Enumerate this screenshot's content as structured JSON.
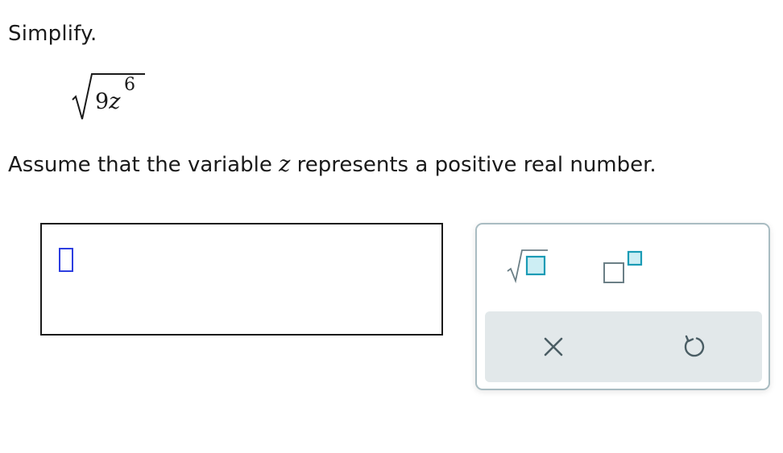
{
  "question": {
    "instruction": "Simplify.",
    "expression": {
      "coefficient": "9",
      "variable": "z",
      "exponent": "6"
    },
    "assumption": {
      "before": "Assume that the variable ",
      "variable": "z",
      "after": " represents a positive real number."
    }
  },
  "answer": {
    "value": ""
  },
  "palette": {
    "tools": [
      {
        "icon": "square-root-icon"
      },
      {
        "icon": "exponent-icon"
      }
    ],
    "actions": [
      {
        "icon": "clear-x-icon"
      },
      {
        "icon": "undo-icon"
      }
    ]
  },
  "colors": {
    "placeholder_border": "#2d3ee0",
    "tool_teal": "#1a9bb5",
    "tool_teal_fill": "#cdeef4",
    "icon_gray": "#6b7f86",
    "action_bar_bg": "#e2e8ea",
    "palette_border": "#a9bcc2"
  }
}
